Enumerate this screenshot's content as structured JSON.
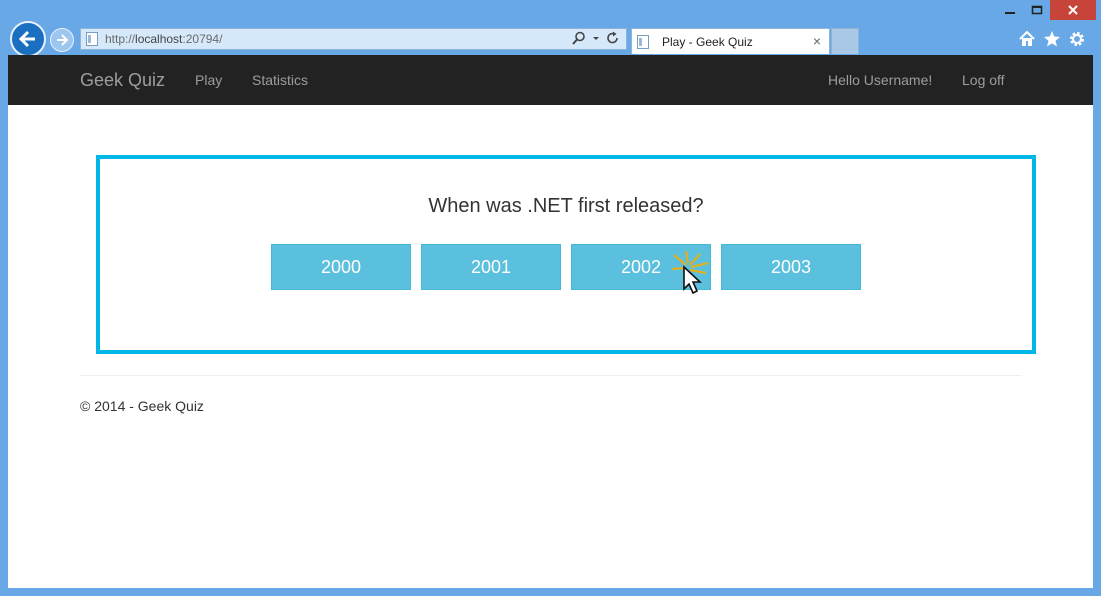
{
  "browser": {
    "url_prefix": "http://",
    "url_host": "localhost",
    "url_rest": ":20794/",
    "tab_title": "Play - Geek Quiz",
    "tab_close": "×"
  },
  "navbar": {
    "brand": "Geek Quiz",
    "links": [
      "Play",
      "Statistics"
    ],
    "greeting": "Hello Username!",
    "logoff": "Log off"
  },
  "quiz": {
    "question": "When was .NET first released?",
    "options": [
      "2000",
      "2001",
      "2002",
      "2003"
    ]
  },
  "footer": {
    "text": "© 2014 - Geek Quiz"
  },
  "colors": {
    "accent": "#00b7e8",
    "button": "#5bc0de",
    "navbar": "#222222"
  },
  "icons": [
    "back-arrow-icon",
    "forward-arrow-icon",
    "page-icon",
    "search-icon",
    "dropdown-icon",
    "refresh-icon",
    "home-icon",
    "star-icon",
    "gear-icon",
    "minimize-icon",
    "maximize-icon",
    "close-icon",
    "mouse-cursor-icon"
  ]
}
